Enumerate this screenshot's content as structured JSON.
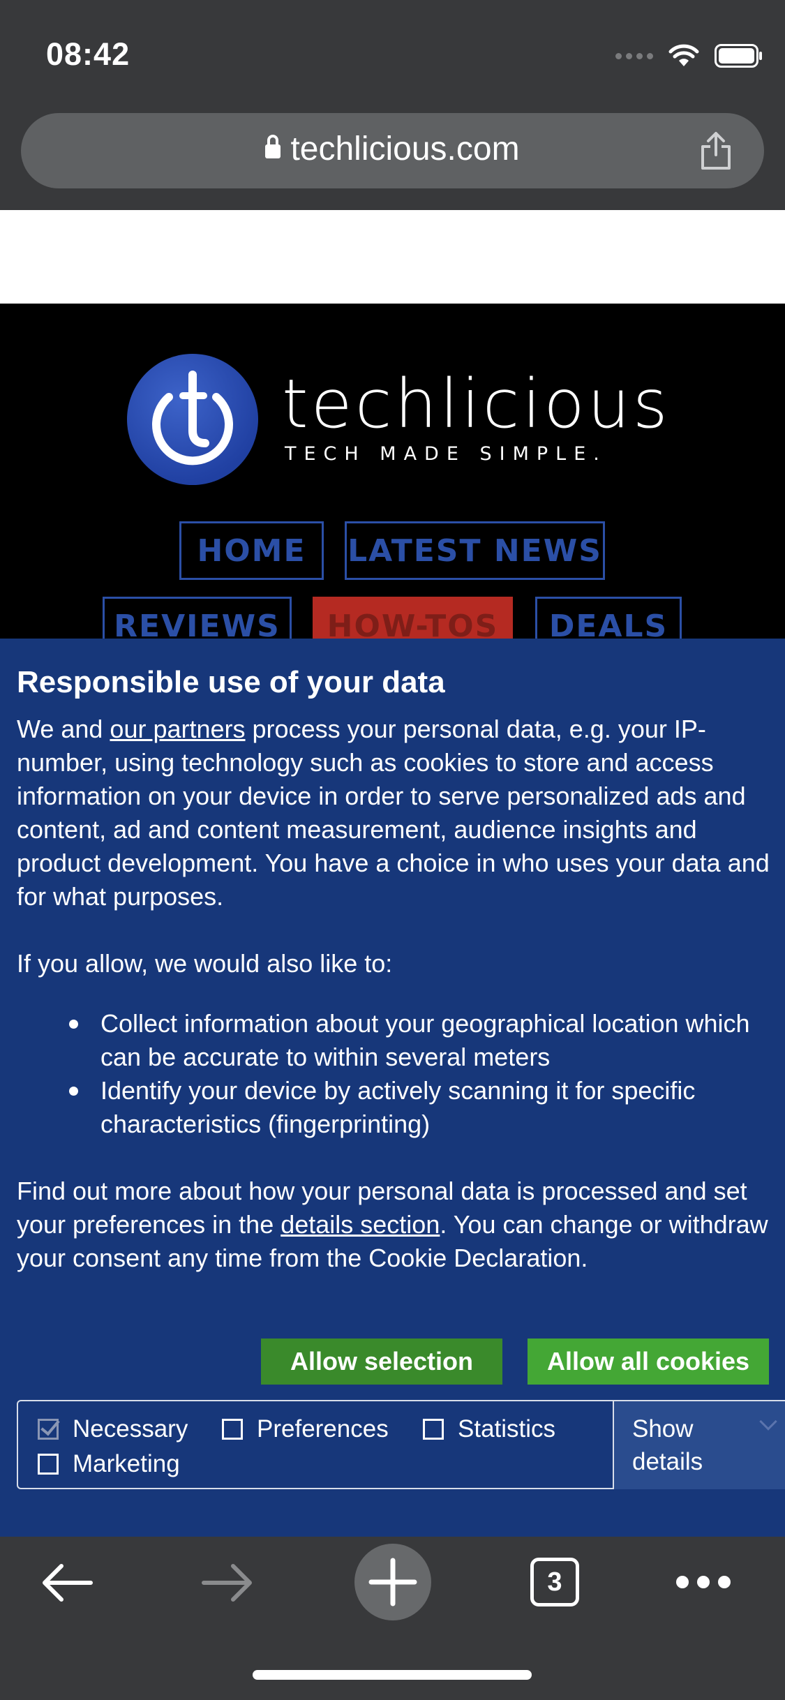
{
  "status_bar": {
    "time": "08:42"
  },
  "browser": {
    "url": "techlicious.com",
    "tab_count": "3"
  },
  "site": {
    "logo_word": "techlicious",
    "tagline": "TECH MADE SIMPLE.",
    "nav": [
      "HOME",
      "LATEST NEWS",
      "REVIEWS",
      "HOW-TOS",
      "DEALS"
    ]
  },
  "consent": {
    "title": "Responsible use of your data",
    "intro_pre": "We and ",
    "intro_link": "our partners",
    "intro_post": " process your personal data, e.g. your IP-number, using technology such as cookies to store and access information on your device in order to serve personalized ads and content, ad and content measurement, audience insights and product development. You have a choice in who uses your data and for what purposes.",
    "allow_intro": "If you allow, we would also like to:",
    "bullets": [
      "Collect information about your geographical location which can be accurate to within several meters",
      "Identify your device by actively scanning it for specific characteristics (fingerprinting)"
    ],
    "more_pre": "Find out more about how your personal data is processed and set your preferences in the ",
    "more_link": "details section",
    "more_post": ". You can change or withdraw your consent any time from the Cookie Declaration.",
    "allow_selection": "Allow selection",
    "allow_all": "Allow all cookies",
    "prefs": {
      "necessary": "Necessary",
      "preferences": "Preferences",
      "statistics": "Statistics",
      "marketing": "Marketing"
    },
    "necessary_checked": true,
    "show_details": "Show details",
    "colors": {
      "banner": "#17377a",
      "button": "#3a8a2b",
      "button_bright": "#44a735"
    }
  },
  "toolbar_icons": [
    "back-arrow-icon",
    "forward-arrow-icon",
    "new-tab-plus-icon",
    "tabs-icon",
    "more-icon"
  ]
}
